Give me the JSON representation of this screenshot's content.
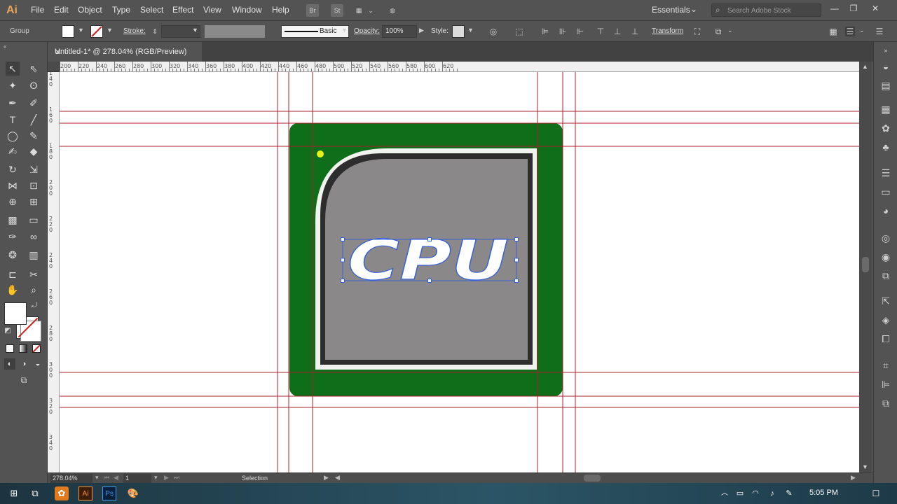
{
  "app": {
    "logo": "Ai",
    "workspace": "Essentials"
  },
  "menu": [
    "File",
    "Edit",
    "Object",
    "Type",
    "Select",
    "Effect",
    "View",
    "Window",
    "Help"
  ],
  "menubar_icons": {
    "bridge": "Br",
    "stock": "St"
  },
  "search": {
    "placeholder": "Search Adobe Stock"
  },
  "control": {
    "selection_type": "Group",
    "stroke_label": "Stroke:",
    "brush_label": "Basic",
    "opacity_label": "Opacity:",
    "opacity_value": "100%",
    "style_label": "Style:",
    "transform_label": "Transform"
  },
  "tab": {
    "title": "Untitled-1* @ 278.04% (RGB/Preview)"
  },
  "ruler": {
    "h_labels": [
      "200",
      "220",
      "240",
      "260",
      "280",
      "300",
      "320",
      "340",
      "360",
      "380",
      "400",
      "420",
      "440",
      "460",
      "480",
      "500",
      "520",
      "540",
      "560",
      "580",
      "600",
      "620"
    ],
    "v_labels": [
      "140",
      "160",
      "180",
      "200",
      "220",
      "240",
      "260",
      "280",
      "300",
      "320",
      "340"
    ]
  },
  "artwork": {
    "chip_label": "CPU",
    "colors": {
      "board": "#0e6e19",
      "frame": "#f0f3ee",
      "die_border": "#2d2d2d",
      "die": "#8a8889",
      "highlight": "#e8f01a",
      "guide": "#a8202a",
      "selection": "#3a62d8"
    }
  },
  "status": {
    "zoom": "278.04%",
    "artboard": "1",
    "tool": "Selection"
  },
  "taskbar": {
    "time": "5:05 PM"
  }
}
